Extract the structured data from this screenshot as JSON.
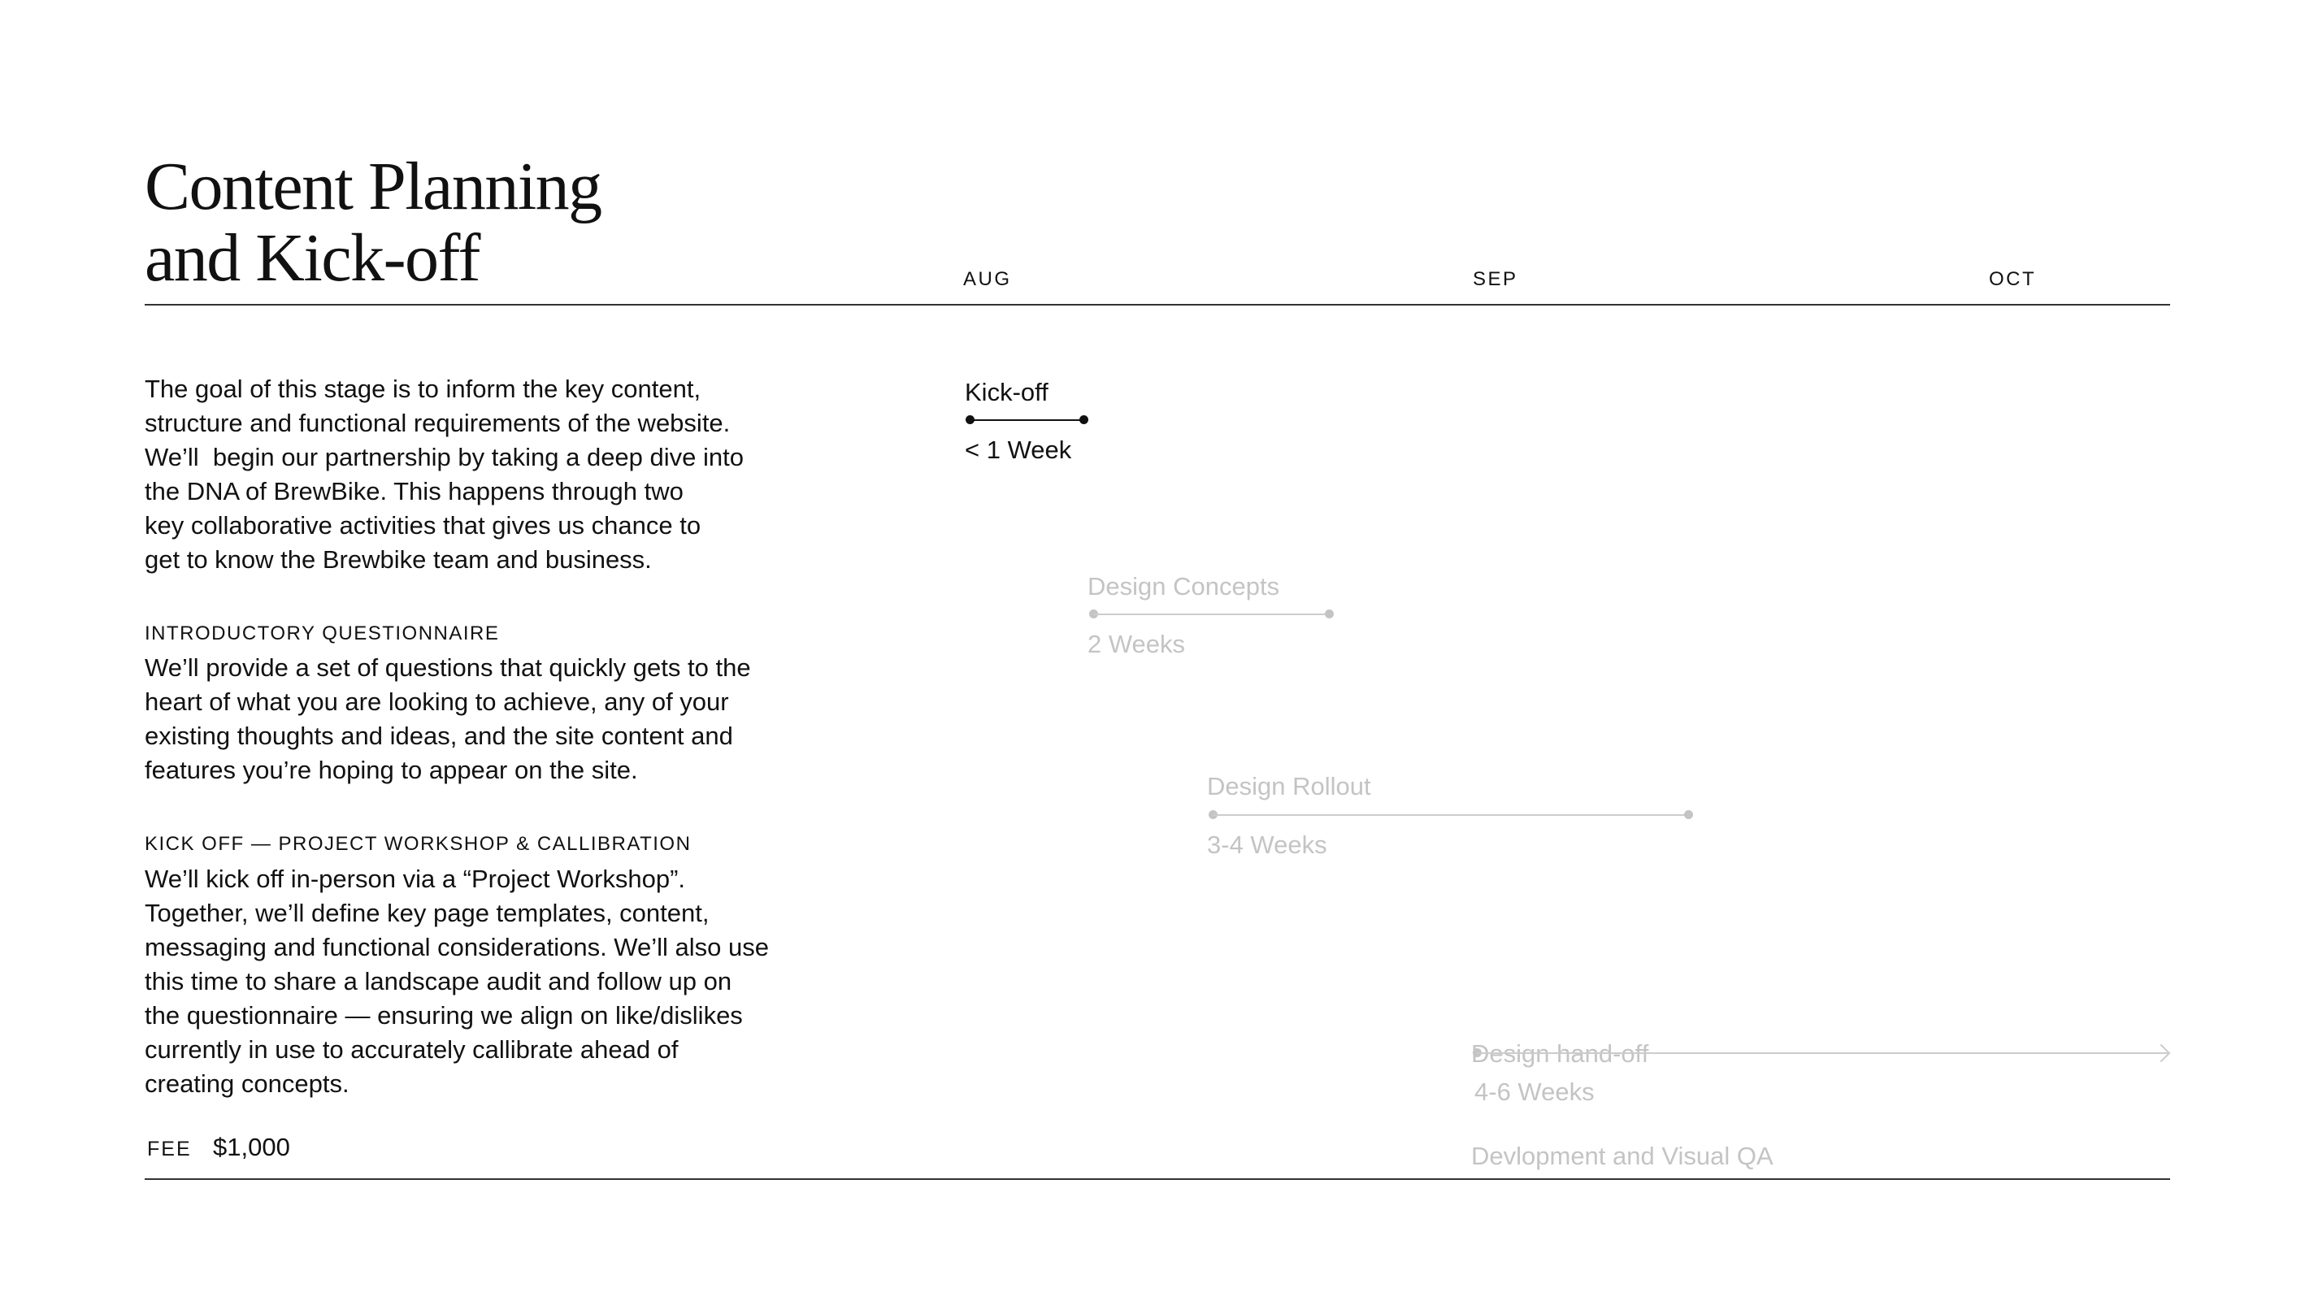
{
  "title": {
    "line1": "Content Planning",
    "line2": "and Kick-off"
  },
  "timeline": {
    "months": [
      "AUG",
      "SEP",
      "OCT"
    ],
    "tasks": [
      {
        "label": "Kick-off",
        "duration": "< 1 Week",
        "active": true
      },
      {
        "label": "Design Concepts",
        "duration": "2 Weeks",
        "active": false
      },
      {
        "label": "Design Rollout",
        "duration": "3-4 Weeks",
        "active": false
      },
      {
        "label_lines": [
          "Design hand-off",
          "Devlopment and Visual QA"
        ],
        "duration": "4-6 Weeks",
        "active": false
      }
    ]
  },
  "intro": {
    "lines": [
      "The goal of this stage is to inform the key content,",
      "structure and functional requirements of the website.",
      "We’ll  begin our partnership by taking a deep dive into",
      "the DNA of BrewBike. This happens through two",
      "key collaborative activities that gives us chance to",
      "get to know the Brewbike team and business."
    ]
  },
  "sections": [
    {
      "heading": "INTRODUCTORY QUESTIONNAIRE",
      "lines": [
        "We’ll provide a set of questions that quickly gets to the",
        "heart of what you are looking to achieve, any of your",
        "existing thoughts and ideas, and the site content and",
        "features you’re hoping to appear on the site."
      ]
    },
    {
      "heading": "KICK OFF — PROJECT WORKSHOP & CALLIBRATION",
      "lines": [
        "We’ll kick off in-person via a “Project Workshop”.",
        "Together, we’ll define key page templates, content,",
        "messaging and functional considerations. We’ll also use",
        "this time to share a landscape audit and follow up on",
        "the questionnaire — ensuring we align on like/dislikes",
        "currently in use to accurately callibrate ahead of",
        "creating concepts."
      ]
    }
  ],
  "fee": {
    "label": "FEE",
    "value": "$1,000"
  },
  "colors": {
    "text": "#111111",
    "rule": "#333333",
    "inactive": "#c4c4c4"
  }
}
